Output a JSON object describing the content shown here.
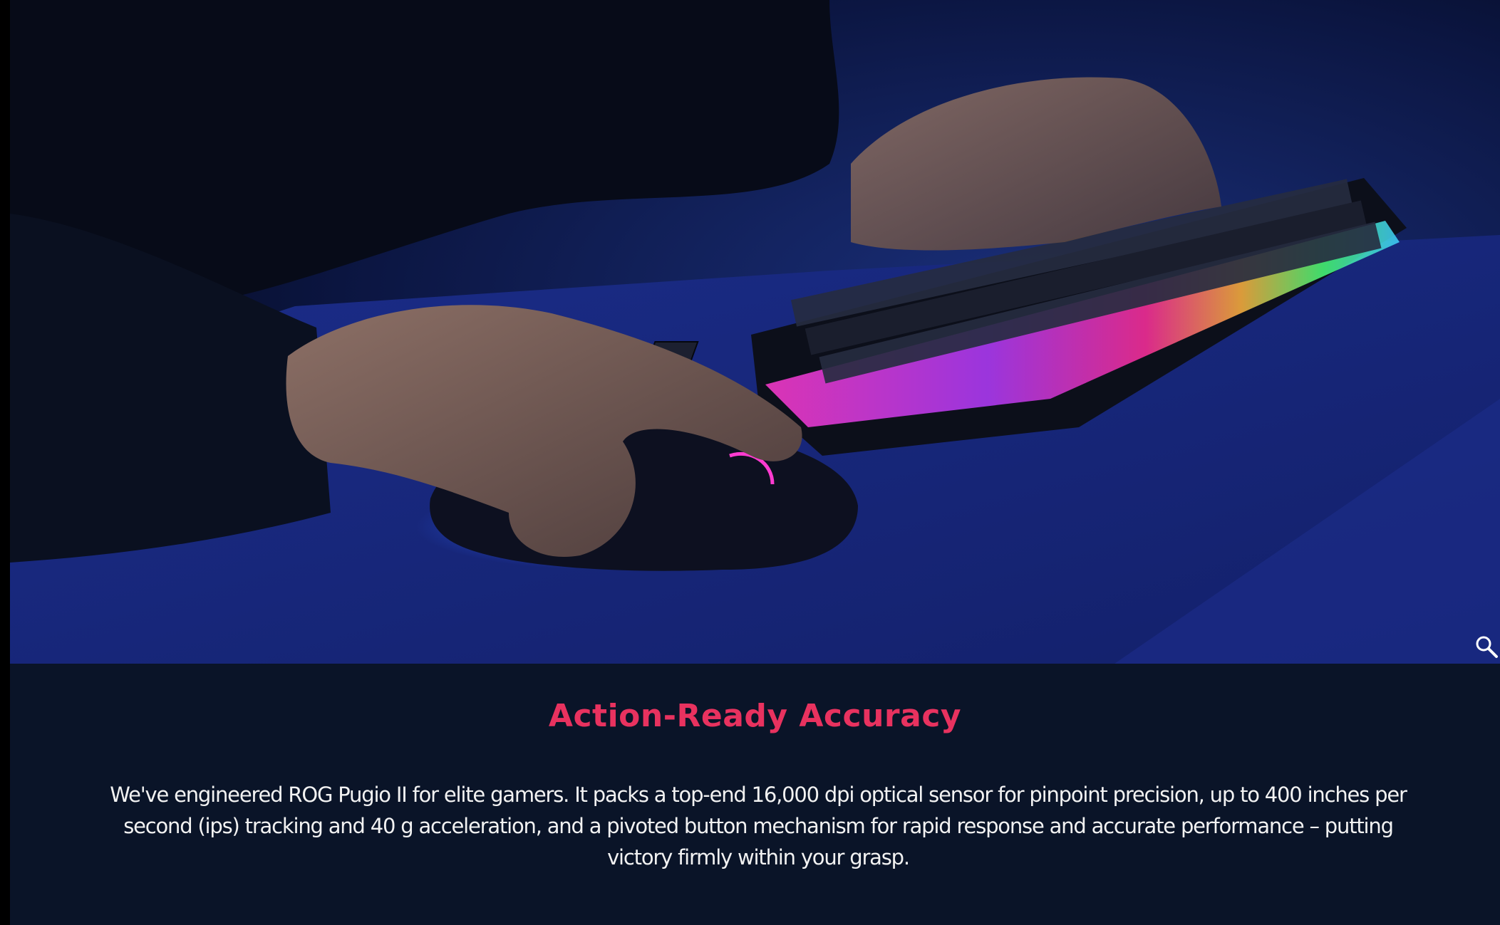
{
  "hero": {
    "image_subject": "keyboard-and-mouse-photo",
    "zoom_icon": "magnifier-icon"
  },
  "section": {
    "heading": "Action-Ready Accuracy",
    "body": "We've engineered ROG Pugio II for elite gamers. It packs a top-end 16,000 dpi optical sensor for pinpoint precision, up to 400 inches per second (ips) tracking and 40 g acceleration, and a pivoted button mechanism for rapid response and accurate performance – putting victory firmly within your grasp."
  },
  "colors": {
    "background": "#0a1428",
    "heading": "#e8325f",
    "body_text": "#f2f2f2",
    "accent_glow": "#2a5cff"
  }
}
